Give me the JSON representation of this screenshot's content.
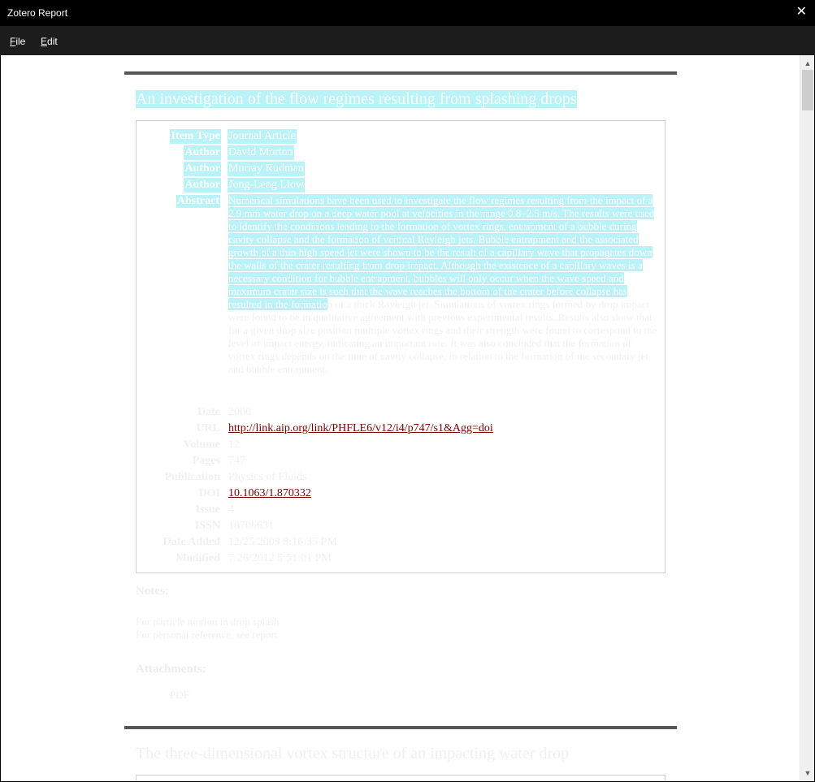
{
  "window": {
    "title": "Zotero Report",
    "close_glyph": "✕"
  },
  "menu": {
    "file_mnemonic": "F",
    "file_rest": "ile",
    "edit_mnemonic": "E",
    "edit_rest": "dit"
  },
  "item1": {
    "title": "An investigation of the flow regimes resulting from splashing drops",
    "rows": {
      "item_type": {
        "label": "Item Type",
        "value": "Journal Article"
      },
      "author1": {
        "label": "Author",
        "value": "David Morton"
      },
      "author2": {
        "label": "Author",
        "value": "Murray Rudman"
      },
      "author3": {
        "label": "Author",
        "value": "Jong-Leng Liow"
      },
      "abstract_label": "Abstract",
      "date": {
        "label": "Date",
        "value": "2000"
      },
      "url": {
        "label": "URL",
        "value": "http://link.aip.org/link/PHFLE6/v12/i4/p747/s1&Agg=doi"
      },
      "volume": {
        "label": "Volume",
        "value": "12"
      },
      "pages": {
        "label": "Pages",
        "value": "747"
      },
      "publication": {
        "label": "Publication",
        "value": "Physics of Fluids"
      },
      "doi": {
        "label": "DOI",
        "value": "10.1063/1.870332"
      },
      "issue": {
        "label": "Issue",
        "value": "4"
      },
      "issn": {
        "label": "ISSN",
        "value": "10706631"
      },
      "date_added": {
        "label": "Date Added",
        "value": "12/25/2009 8:16:35 PM"
      },
      "modified": {
        "label": "Modified",
        "value": "7/26/2012 5:51:01 PM"
      }
    },
    "abstract_selected": "Numerical simulations have been used to investigate the flow regimes resulting from the impact of a 2.9 mm water drop on a deep water pool at velocities in the range 0.8–2.5 m/s. The results were used to identify the conditions leading to the formation of vortex rings, entrapment of a bubble during cavity collapse and the formation of vertical Rayleigh jets. Bubble entrapment and the associated growth of a thin high speed jet were shown to be the result of a capillary wave that propagates down the walls of the crater resulting from drop impact. Although the existence of a capillary waves is a necessary condition for bubble entrapment, bubbles will only occur when the wave speed and maximum crater size is such that the wave reaches the bottom of the crater before collapse has resulted in the formatio",
    "abstract_rest": "n of a thick Rayleigh jet. Simulations of vortex rings formed by drop impact were found to be in qualitative agreement with previous experimental results. Results also show that for a given drop size position multiple vortex rings and their strength were found to correspond to the level of impact energy, indicating an important role. It was also concluded that the formation of vortex rings depends on the time of cavity collapse, in relation to the formation of the secondary jet and bubble entrapment.",
    "notes_head": "Notes:",
    "notes": [
      "For particle motion in drop splash",
      "For personal reference, see report"
    ],
    "attachments_head": "Attachments:",
    "attachment": "PDF"
  },
  "item2": {
    "title": "The three-dimensional vortex structure of an impacting water drop"
  }
}
